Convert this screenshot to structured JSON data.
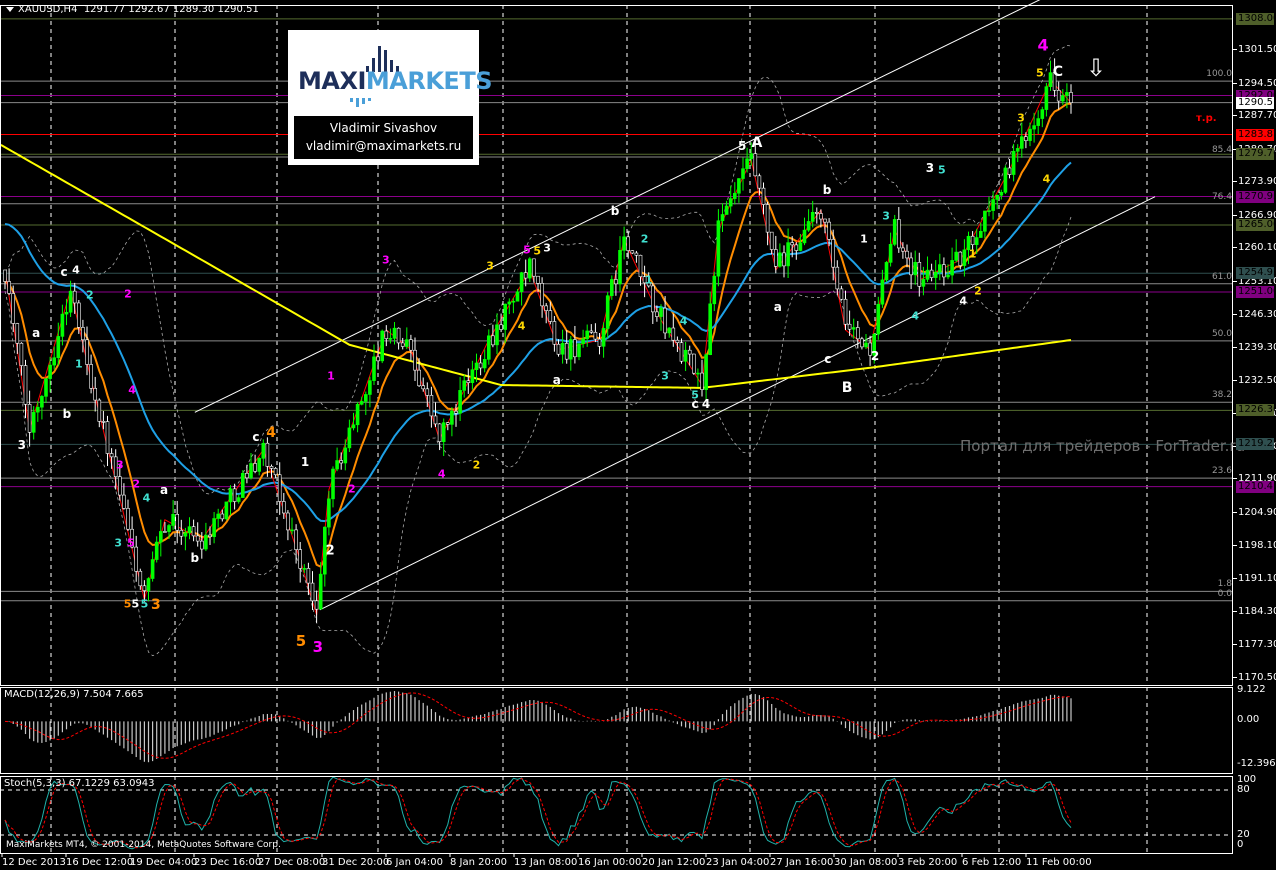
{
  "header": {
    "symbol": "XAUUSD,H4",
    "open": "1291.77",
    "high": "1292.67",
    "low": "1289.30",
    "close": "1290.51"
  },
  "logo": {
    "brand_dark": "MAXI",
    "brand_light": "MARKETS",
    "author": "Vladimir Sivashov",
    "email": "vladimir@maximarkets.ru"
  },
  "watermark": "Портал для трейдеров - ForTrader.ru",
  "copyright": "MaxiMarkets MT4, © 2001-2014, MetaQuotes Software Corp.",
  "target_label": "т.р.",
  "arrow_icon": "⇩",
  "price_axis": [
    "1301.50",
    "1294.50",
    "1287.70",
    "1280.70",
    "1273.90",
    "1266.90",
    "1260.10",
    "1253.10",
    "1246.30",
    "1239.30",
    "1232.50",
    "1225.50",
    "1218.70",
    "1211.90",
    "1204.90",
    "1198.10",
    "1191.10",
    "1184.30",
    "1177.30",
    "1170.50"
  ],
  "price_tags": [
    {
      "text": "1308.00",
      "color": "#4f5f2a",
      "line": "#556b2f"
    },
    {
      "text": "1292.00",
      "color": "#800080",
      "line": "#8b008b"
    },
    {
      "text": "1290.51",
      "color": "#ffffff",
      "line": "#888888"
    },
    {
      "text": "1283.87",
      "color": "#ff0000",
      "line": "#ff0000"
    },
    {
      "text": "1279.76",
      "color": "#4f5f2a",
      "line": "#556b2f"
    },
    {
      "text": "1270.93",
      "color": "#800080",
      "line": "#8b008b"
    },
    {
      "text": "1265.00",
      "color": "#4f5f2a",
      "line": "#556b2f"
    },
    {
      "text": "1254.93",
      "color": "#2f4f4f",
      "line": "#2f4f4f"
    },
    {
      "text": "1251.00",
      "color": "#800080",
      "line": "#8b008b"
    },
    {
      "text": "1226.30",
      "color": "#4f5f2a",
      "line": "#556b2f"
    },
    {
      "text": "1219.23",
      "color": "#2f4f4f",
      "line": "#2f4f4f"
    },
    {
      "text": "1210.41",
      "color": "#800080",
      "line": "#8b008b"
    }
  ],
  "fib_levels": [
    {
      "label": "100.0",
      "ratio": 1.0
    },
    {
      "label": "85.4",
      "ratio": 0.854
    },
    {
      "label": "76.4",
      "ratio": 0.764
    },
    {
      "label": "61.0",
      "ratio": 0.61
    },
    {
      "label": "50.0",
      "ratio": 0.5
    },
    {
      "label": "38.2",
      "ratio": 0.382
    },
    {
      "label": "23.6",
      "ratio": 0.236
    },
    {
      "label": "1.8",
      "ratio": 0.018
    },
    {
      "label": "0.0",
      "ratio": 0.0
    }
  ],
  "fib_range": {
    "low": 1186.6,
    "high": 1295.0
  },
  "time_axis": [
    "12 Dec 2013",
    "16 Dec 12:00",
    "19 Dec 04:00",
    "23 Dec 16:00",
    "27 Dec 08:00",
    "31 Dec 20:00",
    "6 Jan 04:00",
    "8 Jan 20:00",
    "13 Jan 08:00",
    "16 Jan 00:00",
    "20 Jan 12:00",
    "23 Jan 04:00",
    "27 Jan 16:00",
    "30 Jan 08:00",
    "3 Feb 20:00",
    "6 Feb 12:00",
    "11 Feb 00:00"
  ],
  "macd": {
    "label": "MACD(12,26,9) 7.504 7.665",
    "axis": [
      "9.122",
      "0.00",
      "-12.396"
    ],
    "max": 9.122,
    "min": -12.396
  },
  "stoch": {
    "label": "Stoch(5,3,3) 67.1229 63.0943",
    "axis": [
      "100",
      "80",
      "20",
      "0"
    ]
  },
  "colors": {
    "bull": "#00ff00",
    "bear": "#ffffff",
    "ma_fast": "#ff8c00",
    "ma_mid": "#1ea0e6",
    "ma_slow": "#ffff00",
    "channel": "#ffffff",
    "zigzag": "#ff0000",
    "stoch_main": "#20b2aa",
    "stoch_signal": "#ff0000"
  },
  "chart_data": {
    "type": "candlestick",
    "symbol": "XAUUSD",
    "timeframe": "H4",
    "ylim": [
      1170.5,
      1311
    ],
    "candles_count": 261,
    "price_path": [
      [
        0,
        1255.6
      ],
      [
        6,
        1222.2
      ],
      [
        16,
        1251.4
      ],
      [
        21,
        1232.7
      ],
      [
        34,
        1186.8
      ],
      [
        39,
        1203.5
      ],
      [
        48,
        1199.3
      ],
      [
        63,
        1218.1
      ],
      [
        72,
        1195.1
      ],
      [
        76,
        1183.6
      ],
      [
        79,
        1209.8
      ],
      [
        93,
        1243.1
      ],
      [
        99,
        1239
      ],
      [
        106,
        1220.2
      ],
      [
        118,
        1241
      ],
      [
        128,
        1255.6
      ],
      [
        135,
        1239
      ],
      [
        145,
        1241
      ],
      [
        151,
        1261.9
      ],
      [
        160,
        1245.2
      ],
      [
        170,
        1231.6
      ],
      [
        174,
        1264
      ],
      [
        182,
        1278.6
      ],
      [
        188,
        1255.6
      ],
      [
        199,
        1268.1
      ],
      [
        205,
        1243.1
      ],
      [
        211,
        1239
      ],
      [
        217,
        1264
      ],
      [
        223,
        1253.5
      ],
      [
        233,
        1257.7
      ],
      [
        245,
        1276.5
      ],
      [
        255,
        1295.2
      ],
      [
        260,
        1290.5
      ]
    ],
    "slow_ma_path": [
      [
        -1,
        1281.7
      ],
      [
        48,
        1257.7
      ],
      [
        84,
        1240
      ],
      [
        121,
        1231.6
      ],
      [
        170,
        1231
      ],
      [
        211,
        1235.2
      ],
      [
        260,
        1241
      ]
    ],
    "channel_lines": [
      [
        [
          46.3,
          1225.9
        ],
        [
          256,
          1313.5
        ]
      ],
      [
        [
          76.8,
          1184.7
        ],
        [
          280.5,
          1270.9
        ]
      ]
    ],
    "wave_labels": [
      {
        "t": "4",
        "i": 253.2,
        "p": 1302.5,
        "c": "#ff00ff",
        "s": 16
      },
      {
        "t": "C",
        "i": 256.8,
        "p": 1297,
        "c": "#ffffff",
        "s": 14
      },
      {
        "t": "5",
        "i": 252.4,
        "p": 1296.7,
        "c": "#ffd700",
        "s": 11
      },
      {
        "t": "3",
        "i": 247.8,
        "p": 1287.3,
        "c": "#ffd700",
        "s": 11
      },
      {
        "t": "4",
        "i": 254,
        "p": 1274.5,
        "c": "#ffd700",
        "s": 11
      },
      {
        "t": "A",
        "i": 183.4,
        "p": 1282,
        "c": "#ffffff",
        "s": 14
      },
      {
        "t": "5",
        "i": 179.8,
        "p": 1281.5,
        "c": "#ffffff",
        "s": 12
      },
      {
        "t": "b",
        "i": 200.5,
        "p": 1272.3,
        "c": "#ffffff",
        "s": 12
      },
      {
        "t": "a",
        "i": 188.5,
        "p": 1247.9,
        "c": "#ffffff",
        "s": 12
      },
      {
        "t": "c",
        "i": 200.7,
        "p": 1237,
        "c": "#ffffff",
        "s": 12
      },
      {
        "t": "B",
        "i": 205.4,
        "p": 1231,
        "c": "#ffffff",
        "s": 14
      },
      {
        "t": "2",
        "i": 212.2,
        "p": 1237.7,
        "c": "#ffffff",
        "s": 12
      },
      {
        "t": "1",
        "i": 209.5,
        "p": 1262,
        "c": "#ffffff",
        "s": 11
      },
      {
        "t": "3",
        "i": 225.6,
        "p": 1276.9,
        "c": "#ffffff",
        "s": 12
      },
      {
        "t": "5",
        "i": 228.5,
        "p": 1276.5,
        "c": "#40e0d0",
        "s": 11
      },
      {
        "t": "3",
        "i": 214.9,
        "p": 1266.9,
        "c": "#40e0d0",
        "s": 11
      },
      {
        "t": "4",
        "i": 222,
        "p": 1246,
        "c": "#40e0d0",
        "s": 11
      },
      {
        "t": "2",
        "i": 237.3,
        "p": 1251.2,
        "c": "#ffd700",
        "s": 11
      },
      {
        "t": "4",
        "i": 233.7,
        "p": 1249.2,
        "c": "#ffffff",
        "s": 11
      },
      {
        "t": "1",
        "i": 236,
        "p": 1259,
        "c": "#ffd700",
        "s": 11
      },
      {
        "t": "b",
        "i": 148.8,
        "p": 1267.9,
        "c": "#ffffff",
        "s": 12
      },
      {
        "t": "2",
        "i": 156,
        "p": 1262,
        "c": "#40e0d0",
        "s": 11
      },
      {
        "t": "1",
        "i": 157,
        "p": 1253.5,
        "c": "#40e0d0",
        "s": 11
      },
      {
        "t": "a",
        "i": 134.6,
        "p": 1232.7,
        "c": "#ffffff",
        "s": 12
      },
      {
        "t": "3",
        "i": 161,
        "p": 1233.5,
        "c": "#40e0d0",
        "s": 11
      },
      {
        "t": "4",
        "i": 165.5,
        "p": 1245,
        "c": "#40e0d0",
        "s": 11
      },
      {
        "t": "5",
        "i": 168.3,
        "p": 1229.5,
        "c": "#40e0d0",
        "s": 11
      },
      {
        "t": "c",
        "i": 168.3,
        "p": 1227.6,
        "c": "#ffffff",
        "s": 12
      },
      {
        "t": "4",
        "i": 171,
        "p": 1227.6,
        "c": "#ffffff",
        "s": 12
      },
      {
        "t": "5",
        "i": 127.3,
        "p": 1259.8,
        "c": "#ff00ff",
        "s": 11
      },
      {
        "t": "5",
        "i": 129.8,
        "p": 1259.6,
        "c": "#ffd700",
        "s": 11
      },
      {
        "t": "3",
        "i": 132.2,
        "p": 1260.2,
        "c": "#ffffff",
        "s": 11
      },
      {
        "t": "3",
        "i": 118.3,
        "p": 1256.4,
        "c": "#ffd700",
        "s": 11
      },
      {
        "t": "4",
        "i": 126,
        "p": 1244,
        "c": "#ffd700",
        "s": 11
      },
      {
        "t": "3",
        "i": 92.9,
        "p": 1257.7,
        "c": "#ff00ff",
        "s": 11
      },
      {
        "t": "1",
        "i": 79.5,
        "p": 1233.5,
        "c": "#ff00ff",
        "s": 11
      },
      {
        "t": "2",
        "i": 84.6,
        "p": 1210,
        "c": "#ff00ff",
        "s": 11
      },
      {
        "t": "4",
        "i": 106.5,
        "p": 1213,
        "c": "#ff00ff",
        "s": 11
      },
      {
        "t": "2",
        "i": 115,
        "p": 1215,
        "c": "#ffd700",
        "s": 11
      },
      {
        "t": "1",
        "i": 73.2,
        "p": 1215.5,
        "c": "#ffffff",
        "s": 12
      },
      {
        "t": "2",
        "i": 79.3,
        "p": 1197,
        "c": "#ffffff",
        "s": 13
      },
      {
        "t": "5",
        "i": 72.2,
        "p": 1178.2,
        "c": "#ff8c00",
        "s": 15
      },
      {
        "t": "3",
        "i": 76.3,
        "p": 1177,
        "c": "#ff00ff",
        "s": 15
      },
      {
        "t": "c",
        "i": 61.2,
        "p": 1220.8,
        "c": "#ffffff",
        "s": 12
      },
      {
        "t": "4",
        "i": 64.9,
        "p": 1221.6,
        "c": "#ff8c00",
        "s": 14
      },
      {
        "t": "3",
        "i": 36.8,
        "p": 1185.7,
        "c": "#ff8c00",
        "s": 14
      },
      {
        "t": "5",
        "i": 29.9,
        "p": 1185.9,
        "c": "#ff8c00",
        "s": 11
      },
      {
        "t": "5",
        "i": 31.8,
        "p": 1185.9,
        "c": "#ffffff",
        "s": 11
      },
      {
        "t": "5",
        "i": 34,
        "p": 1185.9,
        "c": "#40e0d0",
        "s": 11
      },
      {
        "t": "3",
        "i": 27.6,
        "p": 1198.7,
        "c": "#40e0d0",
        "s": 11
      },
      {
        "t": "5",
        "i": 30.7,
        "p": 1198.7,
        "c": "#ff00ff",
        "s": 11
      },
      {
        "t": "4",
        "i": 34.5,
        "p": 1208,
        "c": "#40e0d0",
        "s": 11
      },
      {
        "t": "2",
        "i": 32,
        "p": 1211,
        "c": "#ff00ff",
        "s": 11
      },
      {
        "t": "a",
        "i": 38.8,
        "p": 1209.7,
        "c": "#ffffff",
        "s": 12
      },
      {
        "t": "b",
        "i": 46.3,
        "p": 1195.5,
        "c": "#ffffff",
        "s": 12
      },
      {
        "t": "c",
        "i": 14.4,
        "p": 1255.2,
        "c": "#ffffff",
        "s": 12
      },
      {
        "t": "4",
        "i": 17.3,
        "p": 1255.6,
        "c": "#ffffff",
        "s": 11
      },
      {
        "t": "2",
        "i": 20.7,
        "p": 1250.3,
        "c": "#40e0d0",
        "s": 11
      },
      {
        "t": "2",
        "i": 30,
        "p": 1250.5,
        "c": "#ff00ff",
        "s": 11
      },
      {
        "t": "4",
        "i": 31,
        "p": 1230.5,
        "c": "#ff00ff",
        "s": 11
      },
      {
        "t": "3",
        "i": 28,
        "p": 1215,
        "c": "#ff00ff",
        "s": 11
      },
      {
        "t": "1",
        "i": 18,
        "p": 1236,
        "c": "#40e0d0",
        "s": 11
      },
      {
        "t": "a",
        "i": 7.6,
        "p": 1242.5,
        "c": "#ffffff",
        "s": 12
      },
      {
        "t": "b",
        "i": 15.1,
        "p": 1225.6,
        "c": "#ffffff",
        "s": 12
      },
      {
        "t": "3",
        "i": 4.1,
        "p": 1219.1,
        "c": "#ffffff",
        "s": 12
      }
    ]
  }
}
